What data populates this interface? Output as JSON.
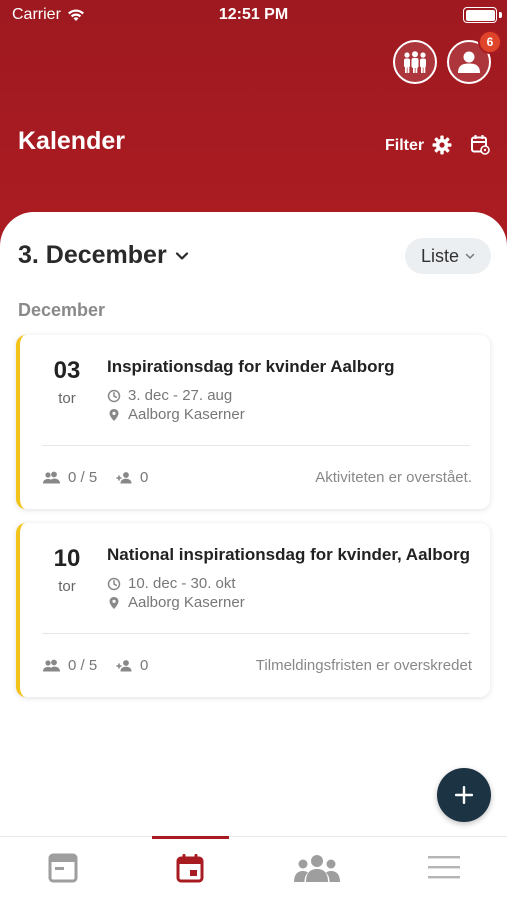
{
  "status_bar": {
    "carrier": "Carrier",
    "time": "12:51 PM"
  },
  "header": {
    "title": "Kalender",
    "filter_label": "Filter",
    "notification_count": "6"
  },
  "calendar": {
    "current_date": "3. December",
    "view_toggle": "Liste",
    "section": "December"
  },
  "events": [
    {
      "day": "03",
      "weekday": "tor",
      "title": "Inspirationsdag for kvinder Aalborg",
      "dates": "3. dec - 27. aug",
      "location": "Aalborg Kaserner",
      "participants": "0 / 5",
      "waitlist": "0",
      "status": "Aktiviteten er overstået."
    },
    {
      "day": "10",
      "weekday": "tor",
      "title": "National inspirationsdag for kvinder, Aalborg",
      "dates": "10. dec - 30. okt",
      "location": "Aalborg Kaserner",
      "participants": "0 / 5",
      "waitlist": "0",
      "status": "Tilmeldingsfristen er overskredet"
    }
  ],
  "tabs": [
    {
      "name": "dashboard",
      "icon": "browser-window-icon",
      "active": false
    },
    {
      "name": "calendar",
      "icon": "calendar-icon",
      "active": true
    },
    {
      "name": "groups",
      "icon": "people-group-icon",
      "active": false
    },
    {
      "name": "menu",
      "icon": "hamburger-menu-icon",
      "active": false
    }
  ],
  "colors": {
    "brand_red": "#a81b21",
    "card_accent": "#f2c318",
    "fab": "#1c3344",
    "badge": "#e0452b"
  }
}
